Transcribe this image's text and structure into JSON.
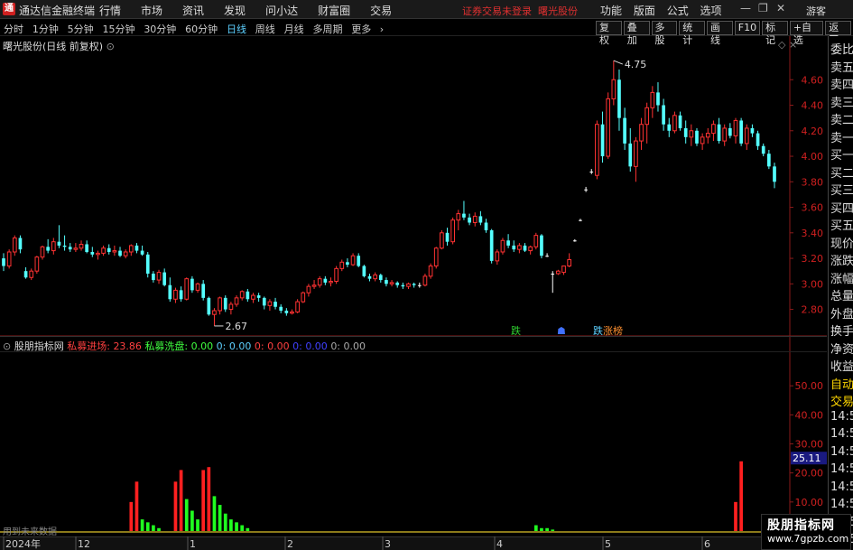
{
  "app": {
    "title": "通达信金融终端",
    "menu": [
      "行情",
      "市场",
      "资讯",
      "发现",
      "问小达",
      "财富圈",
      "交易"
    ],
    "notice": "证券交易未登录",
    "stock_link": "曙光股份",
    "right_menu": [
      "功能",
      "版面",
      "公式",
      "选项"
    ],
    "guest": "游客"
  },
  "toolbar": {
    "periods": [
      "分时",
      "1分钟",
      "5分钟",
      "15分钟",
      "30分钟",
      "60分钟",
      "日线",
      "周线",
      "月线",
      "多周期",
      "更多"
    ],
    "active_period": "日线",
    "buttons": [
      "复权",
      "叠加",
      "多股",
      "统计",
      "画线",
      "F10",
      "标记",
      "+自选",
      "返回"
    ]
  },
  "stock": {
    "header": "曙光股份(日线 前复权)"
  },
  "side_panel": [
    "委比",
    "卖五",
    "卖四",
    "卖三",
    "卖二",
    "卖一",
    "买一",
    "买二",
    "买三",
    "买四",
    "买五",
    "现价",
    "涨跌",
    "涨幅",
    "总量",
    "外盘",
    "换手",
    "净资",
    "收益",
    "自动",
    "交易",
    "14:56",
    "14:56",
    "14:56",
    "14:56",
    "14:56",
    "14:56",
    "14:56",
    "14:56",
    "14:56"
  ],
  "indicator": {
    "name": "股朋指标网",
    "fields": [
      {
        "label": "私募进场:",
        "value": "23.86",
        "color": "#ff4040"
      },
      {
        "label": "私募洗盘:",
        "value": "0.00",
        "color": "#40ff40"
      },
      {
        "label": "0:",
        "value": "0.00",
        "color": "#5dd0ff"
      },
      {
        "label": "0:",
        "value": "0.00",
        "color": "#ff4040"
      },
      {
        "label": "0:",
        "value": "0.00",
        "color": "#4040ff"
      },
      {
        "label": "0:",
        "value": "0.00",
        "color": "#aaaaaa"
      }
    ],
    "current_value": "25.11"
  },
  "hint": "用到未来数据",
  "watermark": {
    "line1": "股朋指标网",
    "line2": "www.7gpzb.com"
  },
  "colors": {
    "up": "#ff3232",
    "down": "#54ffff",
    "flat": "#ffffff"
  },
  "chart_data": [
    {
      "type": "candlestick",
      "title": "曙光股份(日线 前复权)",
      "ylim": [
        2.62,
        4.8
      ],
      "yticks": [
        2.8,
        3.0,
        3.2,
        3.4,
        3.6,
        3.8,
        4.0,
        4.2,
        4.4,
        4.6
      ],
      "x_labels": [
        "2024年",
        "12",
        "1",
        "2",
        "3",
        "4",
        "5",
        "6"
      ],
      "annotations": [
        {
          "label": "4.75",
          "value": 4.75
        },
        {
          "label": "2.67",
          "value": 2.67
        }
      ],
      "markers": [
        "跌",
        "☗",
        "跌",
        "涨榜"
      ],
      "candles": [
        [
          3.2,
          3.24,
          3.1,
          3.14
        ],
        [
          3.14,
          3.27,
          3.12,
          3.25
        ],
        [
          3.25,
          3.38,
          3.22,
          3.36
        ],
        [
          3.36,
          3.38,
          3.24,
          3.27
        ],
        [
          3.1,
          3.13,
          3.04,
          3.05
        ],
        [
          3.05,
          3.12,
          3.03,
          3.1
        ],
        [
          3.1,
          3.22,
          3.08,
          3.21
        ],
        [
          3.21,
          3.3,
          3.19,
          3.29
        ],
        [
          3.29,
          3.35,
          3.24,
          3.26
        ],
        [
          3.26,
          3.36,
          3.23,
          3.33
        ],
        [
          3.33,
          3.46,
          3.28,
          3.3
        ],
        [
          3.3,
          3.38,
          3.26,
          3.29
        ],
        [
          3.29,
          3.32,
          3.25,
          3.27
        ],
        [
          3.27,
          3.32,
          3.25,
          3.28
        ],
        [
          3.28,
          3.34,
          3.26,
          3.31
        ],
        [
          3.31,
          3.34,
          3.24,
          3.25
        ],
        [
          3.25,
          3.29,
          3.21,
          3.23
        ],
        [
          3.23,
          3.26,
          3.19,
          3.24
        ],
        [
          3.24,
          3.3,
          3.22,
          3.28
        ],
        [
          3.28,
          3.31,
          3.23,
          3.25
        ],
        [
          3.25,
          3.3,
          3.22,
          3.26
        ],
        [
          3.26,
          3.29,
          3.21,
          3.22
        ],
        [
          3.22,
          3.27,
          3.2,
          3.25
        ],
        [
          3.25,
          3.31,
          3.22,
          3.3
        ],
        [
          3.3,
          3.32,
          3.24,
          3.26
        ],
        [
          3.26,
          3.3,
          3.22,
          3.23
        ],
        [
          3.23,
          3.25,
          3.05,
          3.08
        ],
        [
          3.08,
          3.1,
          3.01,
          3.03
        ],
        [
          3.03,
          3.11,
          3.0,
          3.09
        ],
        [
          3.09,
          3.12,
          2.98,
          2.99
        ],
        [
          2.99,
          3.05,
          2.86,
          2.88
        ],
        [
          2.88,
          2.97,
          2.85,
          2.95
        ],
        [
          2.95,
          2.98,
          2.86,
          2.88
        ],
        [
          2.88,
          3.05,
          2.87,
          3.04
        ],
        [
          3.04,
          3.06,
          2.93,
          2.95
        ],
        [
          2.95,
          3.01,
          2.93,
          3.0
        ],
        [
          3.0,
          3.03,
          2.87,
          2.89
        ],
        [
          2.89,
          2.9,
          2.75,
          2.76
        ],
        [
          2.76,
          2.81,
          2.67,
          2.79
        ],
        [
          2.79,
          2.9,
          2.76,
          2.89
        ],
        [
          2.89,
          2.91,
          2.78,
          2.8
        ],
        [
          2.8,
          2.86,
          2.76,
          2.84
        ],
        [
          2.84,
          2.91,
          2.82,
          2.89
        ],
        [
          2.89,
          2.95,
          2.87,
          2.94
        ],
        [
          2.94,
          2.96,
          2.86,
          2.88
        ],
        [
          2.88,
          2.93,
          2.85,
          2.91
        ],
        [
          2.91,
          2.93,
          2.86,
          2.89
        ],
        [
          2.89,
          2.9,
          2.8,
          2.83
        ],
        [
          2.83,
          2.88,
          2.79,
          2.86
        ],
        [
          2.86,
          2.89,
          2.8,
          2.82
        ],
        [
          2.82,
          2.84,
          2.77,
          2.79
        ],
        [
          2.79,
          2.81,
          2.75,
          2.77
        ],
        [
          2.77,
          2.8,
          2.76,
          2.78
        ],
        [
          2.78,
          2.88,
          2.77,
          2.86
        ],
        [
          2.86,
          2.94,
          2.85,
          2.93
        ],
        [
          2.93,
          3.0,
          2.9,
          2.98
        ],
        [
          2.98,
          3.03,
          2.96,
          2.99
        ],
        [
          2.99,
          3.06,
          2.97,
          3.04
        ],
        [
          3.04,
          3.06,
          2.99,
          3.01
        ],
        [
          3.01,
          3.05,
          2.98,
          3.02
        ],
        [
          3.02,
          3.14,
          3.0,
          3.12
        ],
        [
          3.12,
          3.19,
          3.1,
          3.17
        ],
        [
          3.17,
          3.2,
          3.13,
          3.15
        ],
        [
          3.15,
          3.24,
          3.14,
          3.22
        ],
        [
          3.22,
          3.24,
          3.13,
          3.14
        ],
        [
          3.14,
          3.15,
          3.05,
          3.06
        ],
        [
          3.06,
          3.08,
          3.02,
          3.04
        ],
        [
          3.04,
          3.09,
          3.02,
          3.07
        ],
        [
          3.07,
          3.08,
          3.01,
          3.03
        ],
        [
          3.03,
          3.05,
          2.98,
          3.0
        ],
        [
          3.0,
          3.03,
          2.98,
          3.01
        ],
        [
          3.01,
          3.02,
          2.97,
          2.99
        ],
        [
          2.99,
          3.01,
          2.96,
          2.98
        ],
        [
          2.98,
          3.01,
          2.96,
          3.0
        ],
        [
          3.0,
          3.01,
          2.97,
          2.99
        ],
        [
          2.99,
          3.01,
          2.97,
          2.99
        ],
        [
          2.99,
          3.08,
          2.98,
          3.06
        ],
        [
          3.06,
          3.16,
          3.04,
          3.14
        ],
        [
          3.14,
          3.29,
          3.12,
          3.28
        ],
        [
          3.28,
          3.42,
          3.27,
          3.4
        ],
        [
          3.4,
          3.44,
          3.3,
          3.33
        ],
        [
          3.33,
          3.52,
          3.31,
          3.5
        ],
        [
          3.5,
          3.58,
          3.42,
          3.55
        ],
        [
          3.55,
          3.65,
          3.5,
          3.52
        ],
        [
          3.52,
          3.55,
          3.46,
          3.48
        ],
        [
          3.48,
          3.56,
          3.45,
          3.53
        ],
        [
          3.53,
          3.57,
          3.46,
          3.48
        ],
        [
          3.48,
          3.51,
          3.4,
          3.42
        ],
        [
          3.42,
          3.43,
          3.16,
          3.18
        ],
        [
          3.18,
          3.27,
          3.15,
          3.25
        ],
        [
          3.25,
          3.36,
          3.23,
          3.34
        ],
        [
          3.34,
          3.39,
          3.28,
          3.3
        ],
        [
          3.3,
          3.34,
          3.25,
          3.27
        ],
        [
          3.27,
          3.32,
          3.24,
          3.3
        ],
        [
          3.3,
          3.32,
          3.25,
          3.26
        ],
        [
          3.26,
          3.3,
          3.23,
          3.29
        ],
        [
          3.29,
          3.4,
          3.27,
          3.38
        ],
        [
          3.38,
          3.39,
          3.2,
          3.22
        ],
        [
          3.22,
          3.24,
          3.21,
          3.22
        ],
        [
          3.08,
          3.1,
          2.93,
          3.08
        ],
        [
          3.08,
          3.11,
          3.07,
          3.1
        ],
        [
          3.09,
          3.14,
          3.07,
          3.14
        ],
        [
          3.14,
          3.24,
          3.13,
          3.19
        ],
        [
          3.34,
          3.35,
          3.33,
          3.34
        ],
        [
          3.5,
          3.51,
          3.49,
          3.5
        ],
        [
          3.74,
          3.76,
          3.72,
          3.74
        ],
        [
          3.88,
          3.9,
          3.86,
          3.88
        ],
        [
          3.85,
          4.28,
          3.82,
          4.25
        ],
        [
          4.25,
          4.35,
          3.95,
          4.0
        ],
        [
          4.0,
          4.5,
          3.98,
          4.45
        ],
        [
          4.45,
          4.75,
          4.4,
          4.6
        ],
        [
          4.6,
          4.68,
          4.2,
          4.3
        ],
        [
          4.3,
          4.38,
          4.05,
          4.1
        ],
        [
          4.1,
          4.22,
          3.88,
          3.92
        ],
        [
          3.92,
          4.15,
          3.8,
          4.12
        ],
        [
          4.12,
          4.3,
          4.05,
          4.25
        ],
        [
          4.25,
          4.42,
          4.1,
          4.38
        ],
        [
          4.38,
          4.55,
          4.3,
          4.5
        ],
        [
          4.5,
          4.58,
          4.35,
          4.4
        ],
        [
          4.4,
          4.45,
          4.2,
          4.25
        ],
        [
          4.25,
          4.3,
          4.15,
          4.2
        ],
        [
          4.2,
          4.35,
          4.18,
          4.32
        ],
        [
          4.32,
          4.35,
          4.2,
          4.22
        ],
        [
          4.22,
          4.28,
          4.1,
          4.15
        ],
        [
          4.15,
          4.25,
          4.08,
          4.2
        ],
        [
          4.2,
          4.22,
          4.08,
          4.1
        ],
        [
          4.1,
          4.18,
          4.05,
          4.15
        ],
        [
          4.15,
          4.22,
          4.1,
          4.18
        ],
        [
          4.18,
          4.28,
          4.12,
          4.25
        ],
        [
          4.25,
          4.3,
          4.1,
          4.12
        ],
        [
          4.12,
          4.25,
          4.08,
          4.22
        ],
        [
          4.22,
          4.26,
          4.14,
          4.16
        ],
        [
          4.16,
          4.3,
          4.1,
          4.28
        ],
        [
          4.28,
          4.3,
          4.08,
          4.1
        ],
        [
          4.1,
          4.25,
          4.05,
          4.22
        ],
        [
          4.22,
          4.25,
          4.15,
          4.18
        ],
        [
          4.18,
          4.2,
          4.05,
          4.08
        ],
        [
          4.08,
          4.1,
          4.0,
          4.02
        ],
        [
          4.02,
          4.05,
          3.9,
          3.92
        ],
        [
          3.92,
          3.95,
          3.75,
          3.8
        ]
      ]
    },
    {
      "type": "bar",
      "title": "股朋指标网",
      "ylim": [
        0,
        60
      ],
      "yticks": [
        10,
        20,
        30,
        40,
        50
      ],
      "series": [
        {
          "name": "私募进场",
          "color": "#ff2020",
          "indices": [
            23,
            24,
            31,
            32,
            36,
            37,
            132,
            133
          ],
          "values": [
            10,
            17,
            17,
            21,
            21,
            22,
            10,
            24
          ]
        },
        {
          "name": "私募洗盘",
          "color": "#20ff20",
          "indices": [
            25,
            26,
            27,
            28,
            33,
            34,
            35,
            38,
            39,
            40,
            41,
            42,
            43,
            44,
            96,
            97,
            98,
            99
          ],
          "values": [
            4,
            3,
            2,
            1,
            11,
            7,
            4,
            12,
            9,
            6,
            4,
            3,
            2,
            1,
            2,
            1,
            1,
            0.5
          ]
        }
      ]
    }
  ]
}
